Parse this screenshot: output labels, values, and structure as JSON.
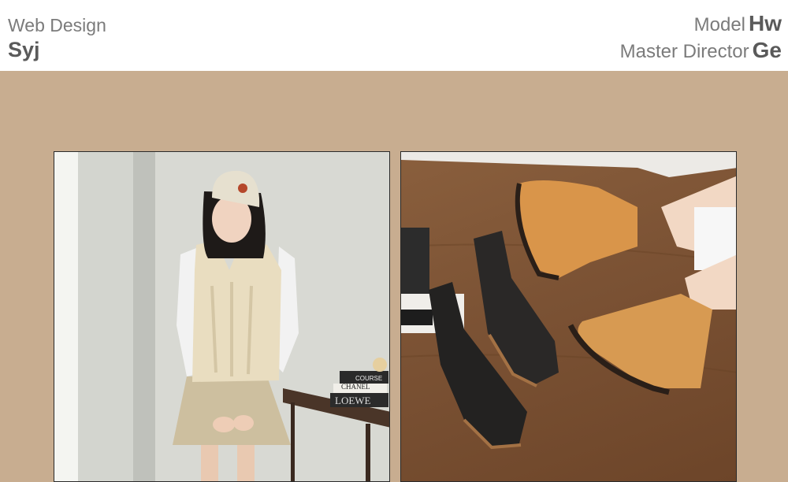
{
  "header": {
    "left": {
      "category": "Web Design",
      "author": "Syj"
    },
    "right": {
      "credits": [
        {
          "role": "Model",
          "name": "Hw"
        },
        {
          "role": "Master Director",
          "name": "Ge"
        }
      ]
    }
  },
  "photos": {
    "left": {
      "book_text_1": "CHANEL",
      "book_text_2": "COURSE",
      "book_text_3": "LOEWE"
    }
  },
  "colors": {
    "band": "#c8ad90",
    "header_bg": "#ffffff",
    "text_gray": "#5a5a5a"
  }
}
